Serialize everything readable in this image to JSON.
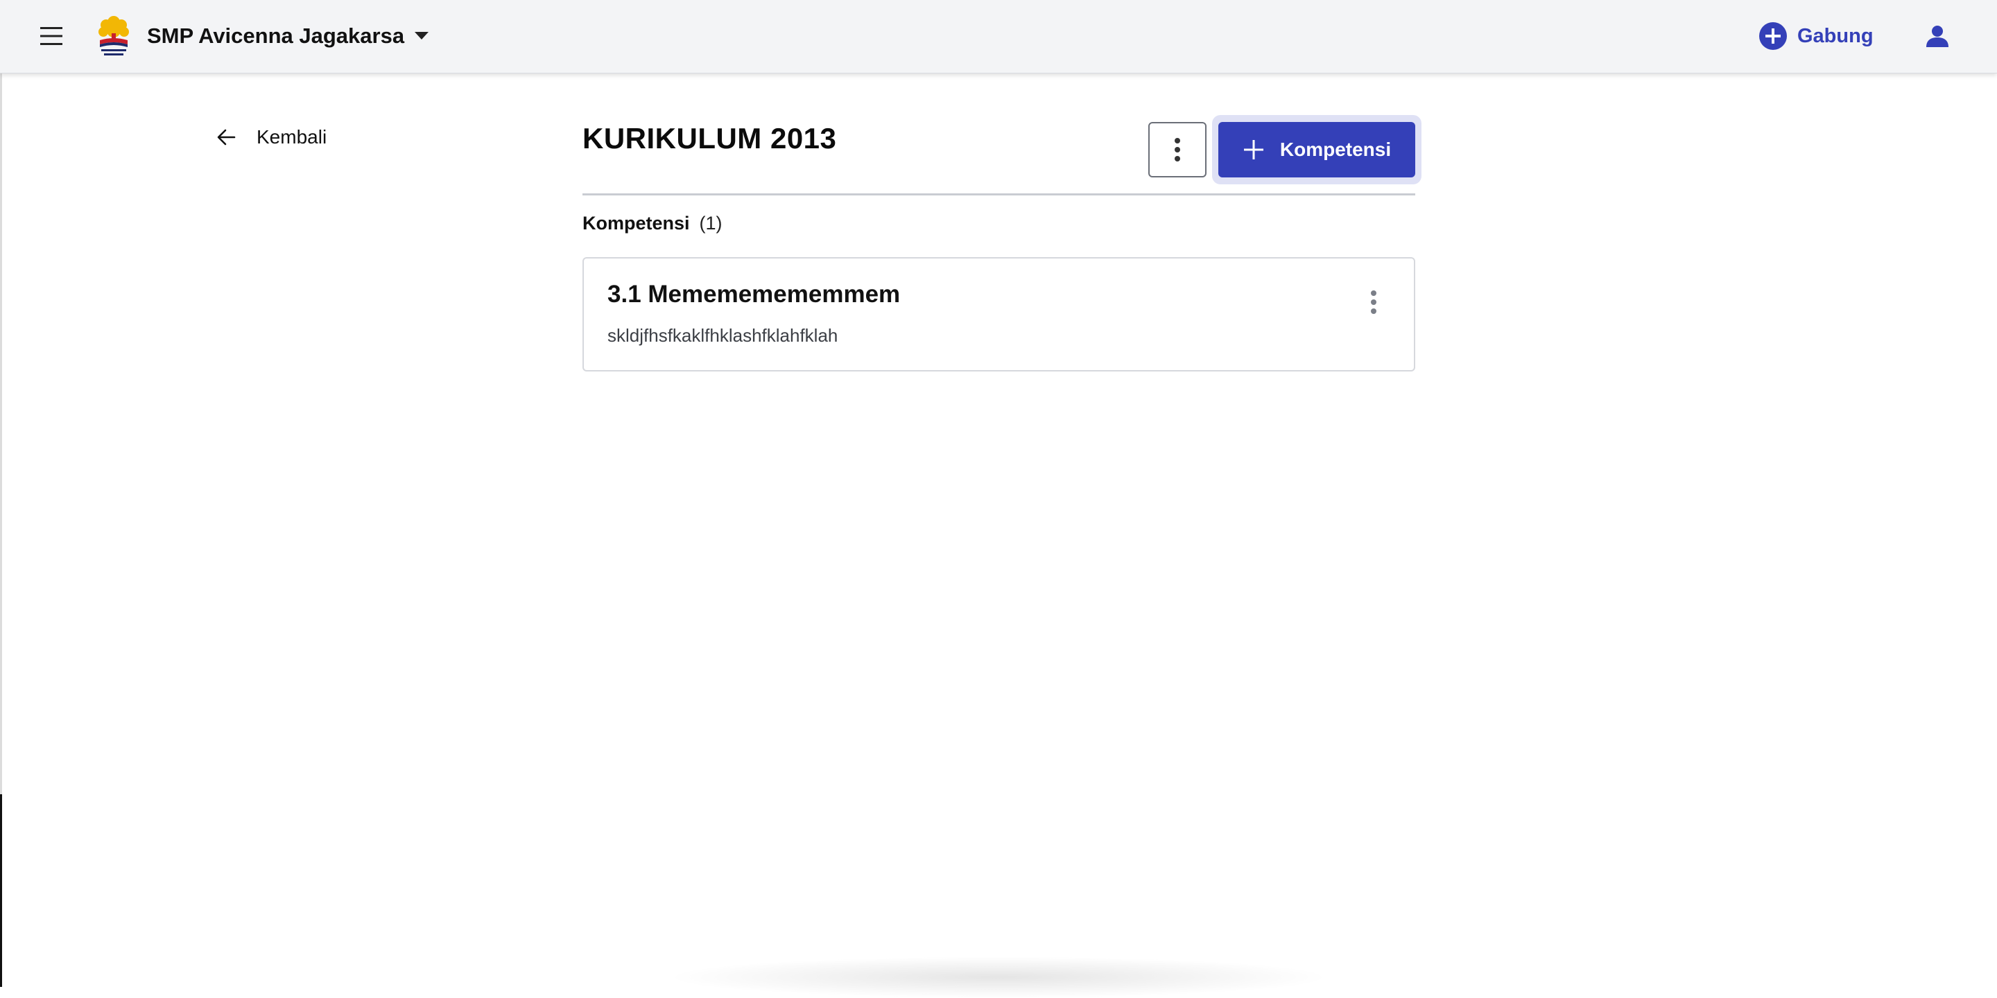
{
  "header": {
    "school_name": "SMP Avicenna Jagakarsa",
    "join_label": "Gabung"
  },
  "nav": {
    "back_label": "Kembali"
  },
  "page": {
    "title": "KURIKULUM 2013",
    "add_button_label": "Kompetensi"
  },
  "section": {
    "label": "Kompetensi",
    "count": "(1)"
  },
  "competencies": [
    {
      "title": "3.1 Memememememmem",
      "description": "skldjfhsfkaklfhklashfklahfklah"
    }
  ],
  "colors": {
    "accent": "#3440b8",
    "topbar_bg": "#f3f4f6",
    "logo_gold": "#f2b705",
    "logo_red": "#c8202c",
    "logo_navy": "#1d2a6b"
  },
  "icons": {
    "menu": "hamburger-menu-icon",
    "dropdown": "caret-down-icon",
    "join": "plus-circle-icon",
    "profile": "person-icon",
    "back": "arrow-left-icon",
    "more": "more-vertical-icon",
    "add": "plus-icon"
  }
}
